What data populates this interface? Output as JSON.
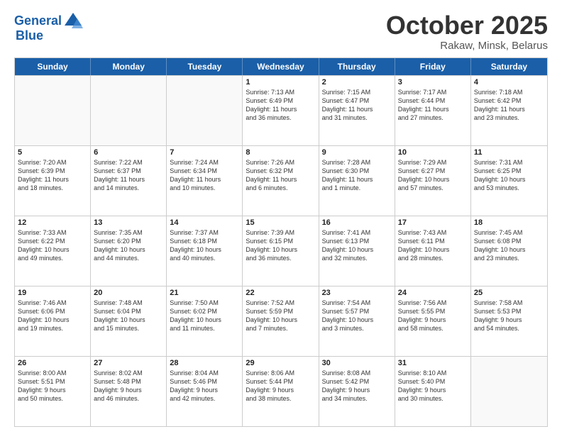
{
  "header": {
    "logo_line1": "General",
    "logo_line2": "Blue",
    "title": "October 2025",
    "subtitle": "Rakaw, Minsk, Belarus"
  },
  "weekdays": [
    "Sunday",
    "Monday",
    "Tuesday",
    "Wednesday",
    "Thursday",
    "Friday",
    "Saturday"
  ],
  "rows": [
    [
      {
        "day": "",
        "info": ""
      },
      {
        "day": "",
        "info": ""
      },
      {
        "day": "",
        "info": ""
      },
      {
        "day": "1",
        "info": "Sunrise: 7:13 AM\nSunset: 6:49 PM\nDaylight: 11 hours\nand 36 minutes."
      },
      {
        "day": "2",
        "info": "Sunrise: 7:15 AM\nSunset: 6:47 PM\nDaylight: 11 hours\nand 31 minutes."
      },
      {
        "day": "3",
        "info": "Sunrise: 7:17 AM\nSunset: 6:44 PM\nDaylight: 11 hours\nand 27 minutes."
      },
      {
        "day": "4",
        "info": "Sunrise: 7:18 AM\nSunset: 6:42 PM\nDaylight: 11 hours\nand 23 minutes."
      }
    ],
    [
      {
        "day": "5",
        "info": "Sunrise: 7:20 AM\nSunset: 6:39 PM\nDaylight: 11 hours\nand 18 minutes."
      },
      {
        "day": "6",
        "info": "Sunrise: 7:22 AM\nSunset: 6:37 PM\nDaylight: 11 hours\nand 14 minutes."
      },
      {
        "day": "7",
        "info": "Sunrise: 7:24 AM\nSunset: 6:34 PM\nDaylight: 11 hours\nand 10 minutes."
      },
      {
        "day": "8",
        "info": "Sunrise: 7:26 AM\nSunset: 6:32 PM\nDaylight: 11 hours\nand 6 minutes."
      },
      {
        "day": "9",
        "info": "Sunrise: 7:28 AM\nSunset: 6:30 PM\nDaylight: 11 hours\nand 1 minute."
      },
      {
        "day": "10",
        "info": "Sunrise: 7:29 AM\nSunset: 6:27 PM\nDaylight: 10 hours\nand 57 minutes."
      },
      {
        "day": "11",
        "info": "Sunrise: 7:31 AM\nSunset: 6:25 PM\nDaylight: 10 hours\nand 53 minutes."
      }
    ],
    [
      {
        "day": "12",
        "info": "Sunrise: 7:33 AM\nSunset: 6:22 PM\nDaylight: 10 hours\nand 49 minutes."
      },
      {
        "day": "13",
        "info": "Sunrise: 7:35 AM\nSunset: 6:20 PM\nDaylight: 10 hours\nand 44 minutes."
      },
      {
        "day": "14",
        "info": "Sunrise: 7:37 AM\nSunset: 6:18 PM\nDaylight: 10 hours\nand 40 minutes."
      },
      {
        "day": "15",
        "info": "Sunrise: 7:39 AM\nSunset: 6:15 PM\nDaylight: 10 hours\nand 36 minutes."
      },
      {
        "day": "16",
        "info": "Sunrise: 7:41 AM\nSunset: 6:13 PM\nDaylight: 10 hours\nand 32 minutes."
      },
      {
        "day": "17",
        "info": "Sunrise: 7:43 AM\nSunset: 6:11 PM\nDaylight: 10 hours\nand 28 minutes."
      },
      {
        "day": "18",
        "info": "Sunrise: 7:45 AM\nSunset: 6:08 PM\nDaylight: 10 hours\nand 23 minutes."
      }
    ],
    [
      {
        "day": "19",
        "info": "Sunrise: 7:46 AM\nSunset: 6:06 PM\nDaylight: 10 hours\nand 19 minutes."
      },
      {
        "day": "20",
        "info": "Sunrise: 7:48 AM\nSunset: 6:04 PM\nDaylight: 10 hours\nand 15 minutes."
      },
      {
        "day": "21",
        "info": "Sunrise: 7:50 AM\nSunset: 6:02 PM\nDaylight: 10 hours\nand 11 minutes."
      },
      {
        "day": "22",
        "info": "Sunrise: 7:52 AM\nSunset: 5:59 PM\nDaylight: 10 hours\nand 7 minutes."
      },
      {
        "day": "23",
        "info": "Sunrise: 7:54 AM\nSunset: 5:57 PM\nDaylight: 10 hours\nand 3 minutes."
      },
      {
        "day": "24",
        "info": "Sunrise: 7:56 AM\nSunset: 5:55 PM\nDaylight: 9 hours\nand 58 minutes."
      },
      {
        "day": "25",
        "info": "Sunrise: 7:58 AM\nSunset: 5:53 PM\nDaylight: 9 hours\nand 54 minutes."
      }
    ],
    [
      {
        "day": "26",
        "info": "Sunrise: 8:00 AM\nSunset: 5:51 PM\nDaylight: 9 hours\nand 50 minutes."
      },
      {
        "day": "27",
        "info": "Sunrise: 8:02 AM\nSunset: 5:48 PM\nDaylight: 9 hours\nand 46 minutes."
      },
      {
        "day": "28",
        "info": "Sunrise: 8:04 AM\nSunset: 5:46 PM\nDaylight: 9 hours\nand 42 minutes."
      },
      {
        "day": "29",
        "info": "Sunrise: 8:06 AM\nSunset: 5:44 PM\nDaylight: 9 hours\nand 38 minutes."
      },
      {
        "day": "30",
        "info": "Sunrise: 8:08 AM\nSunset: 5:42 PM\nDaylight: 9 hours\nand 34 minutes."
      },
      {
        "day": "31",
        "info": "Sunrise: 8:10 AM\nSunset: 5:40 PM\nDaylight: 9 hours\nand 30 minutes."
      },
      {
        "day": "",
        "info": ""
      }
    ]
  ]
}
